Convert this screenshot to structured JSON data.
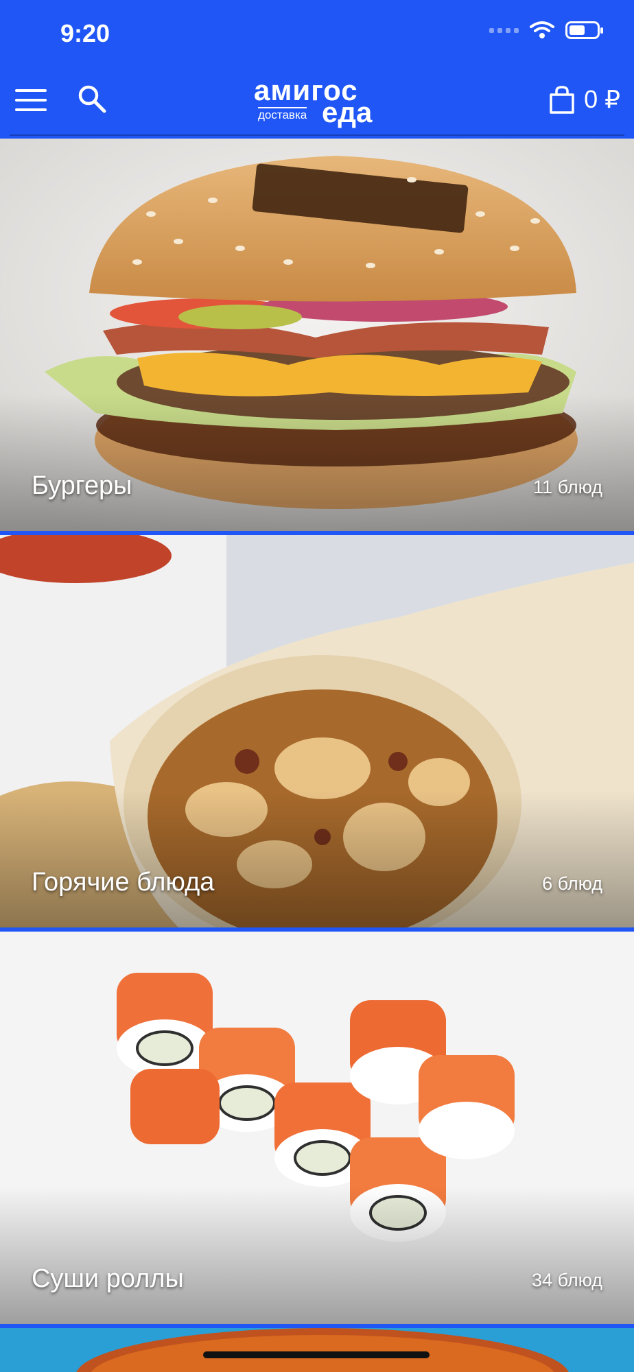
{
  "status_bar": {
    "time": "9:20"
  },
  "header": {
    "logo": {
      "line1": "амигос",
      "line2": "доставка",
      "line3": "еда"
    },
    "cart_total": "0 ₽"
  },
  "categories": [
    {
      "name": "Бургеры",
      "count": "11 блюд"
    },
    {
      "name": "Горячие блюда",
      "count": "6 блюд"
    },
    {
      "name": "Суши роллы",
      "count": "34 блюд"
    }
  ],
  "colors": {
    "brand_blue": "#1f56f5"
  }
}
